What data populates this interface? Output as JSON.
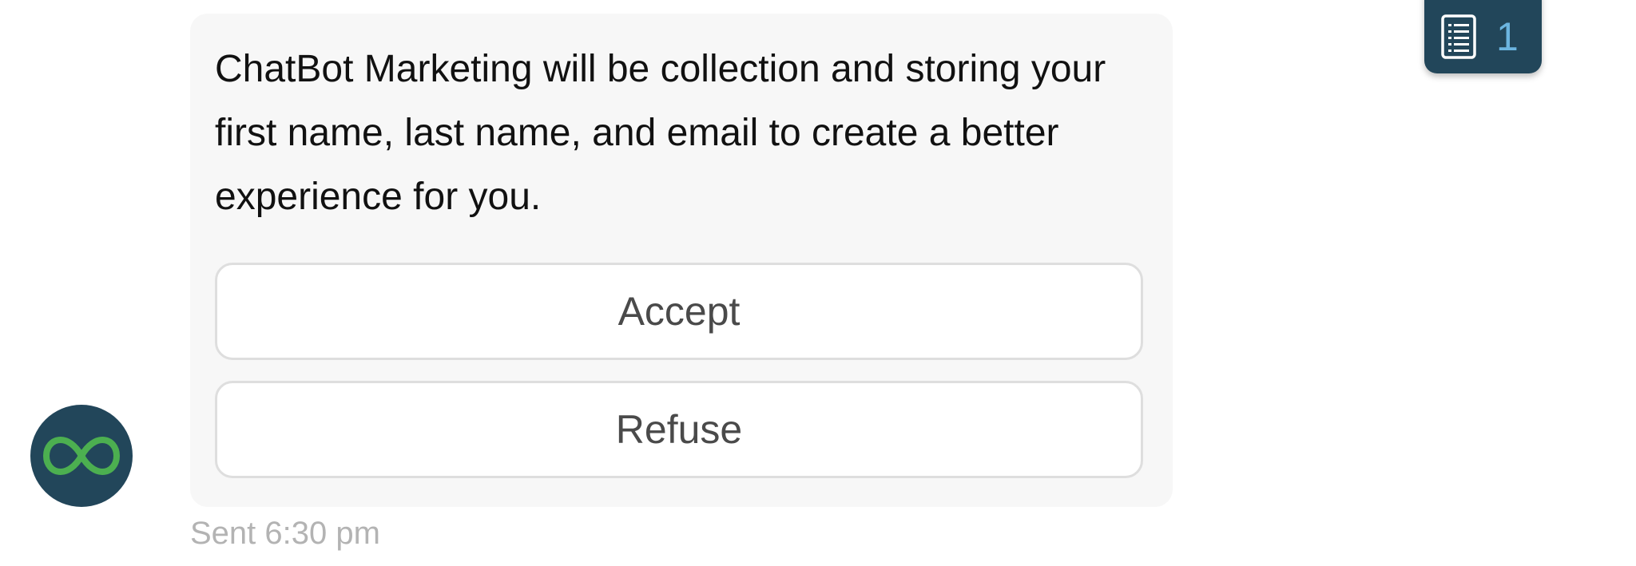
{
  "message": {
    "text": "ChatBot Marketing will be collection and storing your first name, last name, and email to create a better experience for you.",
    "buttons": {
      "accept_label": "Accept",
      "refuse_label": "Refuse"
    },
    "timestamp": "Sent 6:30 pm"
  },
  "avatar": {
    "icon": "infinity-logo-icon",
    "background": "#22465a",
    "accent": "#4caf50"
  },
  "counter": {
    "icon": "document-list-icon",
    "count": "1",
    "background": "#22465a",
    "count_color": "#6cb5e0"
  }
}
